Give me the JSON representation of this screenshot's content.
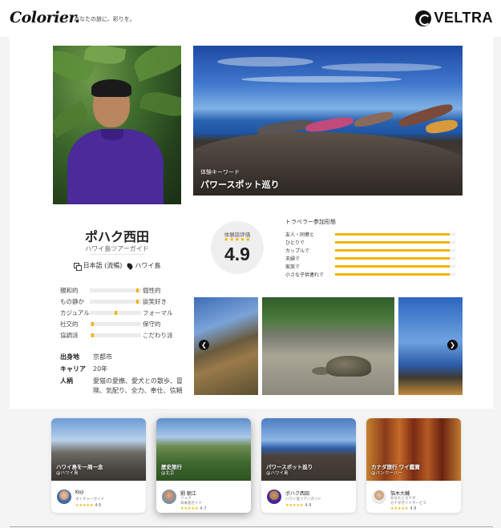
{
  "header": {
    "logo": "Colorier.",
    "tagline": "あなたの旅に、彩りを。",
    "brand": "VELTRA"
  },
  "profile": {
    "name": "ポハク西田",
    "role": "ハワイ島ツアーガイド",
    "language": "日本語 (流暢)",
    "location": "ハワイ島",
    "traits": [
      {
        "left": "親和的",
        "right": "個性的",
        "value": 0.95
      },
      {
        "left": "もの静か",
        "right": "談笑好き",
        "value": 0.95
      },
      {
        "left": "カジュアル",
        "right": "フォーマル",
        "value": 0.5
      },
      {
        "left": "社交的",
        "right": "保守的",
        "value": 0.03
      },
      {
        "left": "協調派",
        "right": "こだわり派",
        "value": 0.03
      }
    ],
    "info": [
      {
        "label": "出身地",
        "value": "京都市"
      },
      {
        "label": "キャリア",
        "value": "20年"
      },
      {
        "label": "人柄",
        "value": "愛猫の愛撫、愛犬との散歩、冒険、気配り、全力、奉仕、信頼"
      }
    ]
  },
  "hero": {
    "label": "体験キーワード",
    "title": "パワースポット巡り"
  },
  "rating": {
    "label": "体験談評価",
    "stars": "★★★★★",
    "score": "4.9"
  },
  "participants": {
    "title": "トラベラー参加形態",
    "rows": [
      {
        "label": "友人・同僚と",
        "value": 0.95
      },
      {
        "label": "ひとりで",
        "value": 0.95
      },
      {
        "label": "カップルで",
        "value": 0.95
      },
      {
        "label": "夫婦で",
        "value": 0.95
      },
      {
        "label": "家族で",
        "value": 0.95
      },
      {
        "label": "小さな子供連れで",
        "value": 0.95
      }
    ]
  },
  "carousel": {
    "prev_icon": "chevron-left-icon",
    "next_icon": "chevron-right-icon"
  },
  "tours": [
    {
      "title": "ハワイ島を一周一念",
      "area": "@ハワイ島",
      "guide": "Koji",
      "guide_role": "ネイチャーガイド",
      "stars": "★★★★★",
      "score": "4.6"
    },
    {
      "title": "歴史旅行",
      "area": "@北京",
      "guide": "劉 朝江",
      "guide_role": "リュウ\n日本語ガイド",
      "stars": "★★★★★",
      "score": "4.7"
    },
    {
      "title": "パワースポット巡り",
      "area": "@ハワイ島",
      "guide": "ポハク西田",
      "guide_role": "ハワイ島ツアーガイド",
      "stars": "★★★★★",
      "score": "4.9"
    },
    {
      "title": "カナダ旅行 ワイ鑑賞",
      "area": "@バンクーバー",
      "guide": "箔木大輔",
      "guide_role": "あなたとカナダ\nカナダガイドサービス",
      "stars": "★★★★★",
      "score": "4.8"
    }
  ]
}
